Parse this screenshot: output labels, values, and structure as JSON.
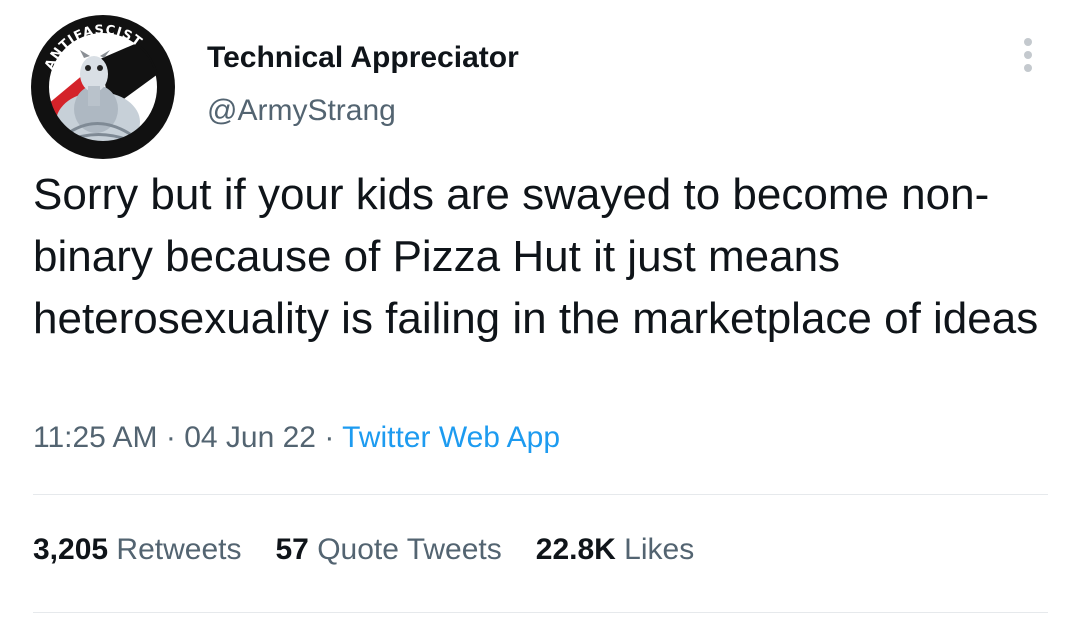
{
  "user": {
    "display_name": "Technical Appreciator",
    "handle": "@ArmyStrang",
    "avatar_text": "ANTIFASCIST"
  },
  "tweet": {
    "text": "Sorry but if your kids are swayed to become non-binary because of Pizza Hut it just means heterosexuality is failing in the marketplace of ideas",
    "time": "11:25 AM",
    "date": "04 Jun 22",
    "separator": "·",
    "source": "Twitter Web App"
  },
  "stats": {
    "retweets_count": "3,205",
    "retweets_label": "Retweets",
    "quotes_count": "57",
    "quotes_label": "Quote Tweets",
    "likes_count": "22.8K",
    "likes_label": "Likes"
  },
  "colors": {
    "text_primary": "#0f1419",
    "text_secondary": "#536471",
    "link": "#1d9bf0",
    "divider": "#e6e9ec"
  },
  "icons": {
    "more": "more-vertical-icon"
  }
}
